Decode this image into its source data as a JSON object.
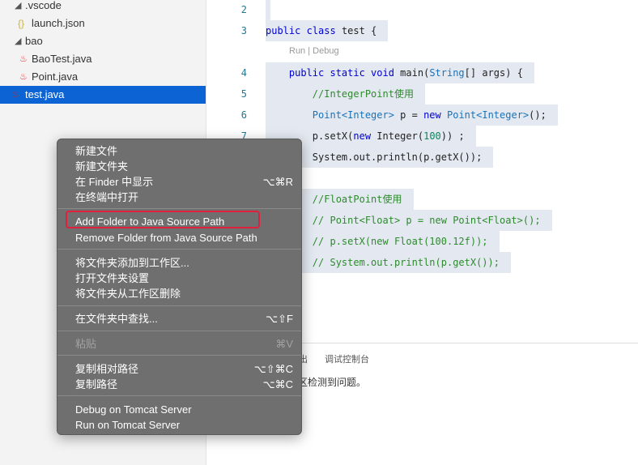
{
  "sidebar": {
    "items": [
      {
        "label": ".vscode",
        "icon": "chevron-down-icon"
      },
      {
        "label": "launch.json",
        "icon": "json-braces-icon"
      },
      {
        "label": "bao",
        "icon": "chevron-down-icon"
      },
      {
        "label": "BaoTest.java",
        "icon": "java-icon"
      },
      {
        "label": "Point.java",
        "icon": "java-icon"
      },
      {
        "label": "test.java",
        "icon": "java-icon",
        "selected": true
      }
    ]
  },
  "editor": {
    "line_numbers": [
      "2",
      "3",
      "4",
      "5",
      "6",
      "7"
    ],
    "codelens": "Run | Debug",
    "code": {
      "l3a": "public",
      "l3b": " ",
      "l3c": "class",
      "l3d": " test {",
      "l4a": "    public static void",
      "l4b": " main(",
      "l4c": "String",
      "l4d": "[] args) {",
      "l5": "        //IntegerPoint使用",
      "l6a": "        Point<Integer>",
      "l6b": " p = ",
      "l6c": "new",
      "l6d": " ",
      "l6e": "Point<Integer>",
      "l6f": "();",
      "l7a": "        p.setX(",
      "l7b": "new",
      "l7c": " Integer(",
      "l7d": "100",
      "l7e": ")) ;",
      "l8": "        System.out.println(p.getX());",
      "l10": "        //FloatPoint使用",
      "l11": "        // Point<Float> p = new Point<Float>();",
      "l12": "        // p.setX(new Float(100.12f));",
      "l13": "        // System.out.println(p.getX());"
    }
  },
  "panel": {
    "tab_partial": "出",
    "tab_debug": "调试控制台",
    "message_partial": "区检测到问题。"
  },
  "menu": {
    "items": [
      {
        "label": "新建文件",
        "shortcut": ""
      },
      {
        "label": "新建文件夹",
        "shortcut": ""
      },
      {
        "label": "在 Finder 中显示",
        "shortcut": "⌥⌘R"
      },
      {
        "label": "在终端中打开",
        "shortcut": ""
      },
      {
        "label": "Add Folder to Java Source Path",
        "shortcut": "",
        "highlighted": true
      },
      {
        "label": "Remove Folder from Java Source Path",
        "shortcut": ""
      },
      {
        "label": "将文件夹添加到工作区...",
        "shortcut": ""
      },
      {
        "label": "打开文件夹设置",
        "shortcut": ""
      },
      {
        "label": "将文件夹从工作区删除",
        "shortcut": ""
      },
      {
        "label": "在文件夹中查找...",
        "shortcut": "⌥⇧F"
      },
      {
        "label": "粘贴",
        "shortcut": "⌘V",
        "disabled": true
      },
      {
        "label": "复制相对路径",
        "shortcut": "⌥⇧⌘C"
      },
      {
        "label": "复制路径",
        "shortcut": "⌥⌘C"
      },
      {
        "label": "Debug on Tomcat Server",
        "shortcut": ""
      },
      {
        "label": "Run on Tomcat Server",
        "shortcut": ""
      }
    ]
  },
  "colors": {
    "selection": "#0c64d4",
    "highlight_box": "#e0203c",
    "menu_bg": "#6f6f70"
  }
}
